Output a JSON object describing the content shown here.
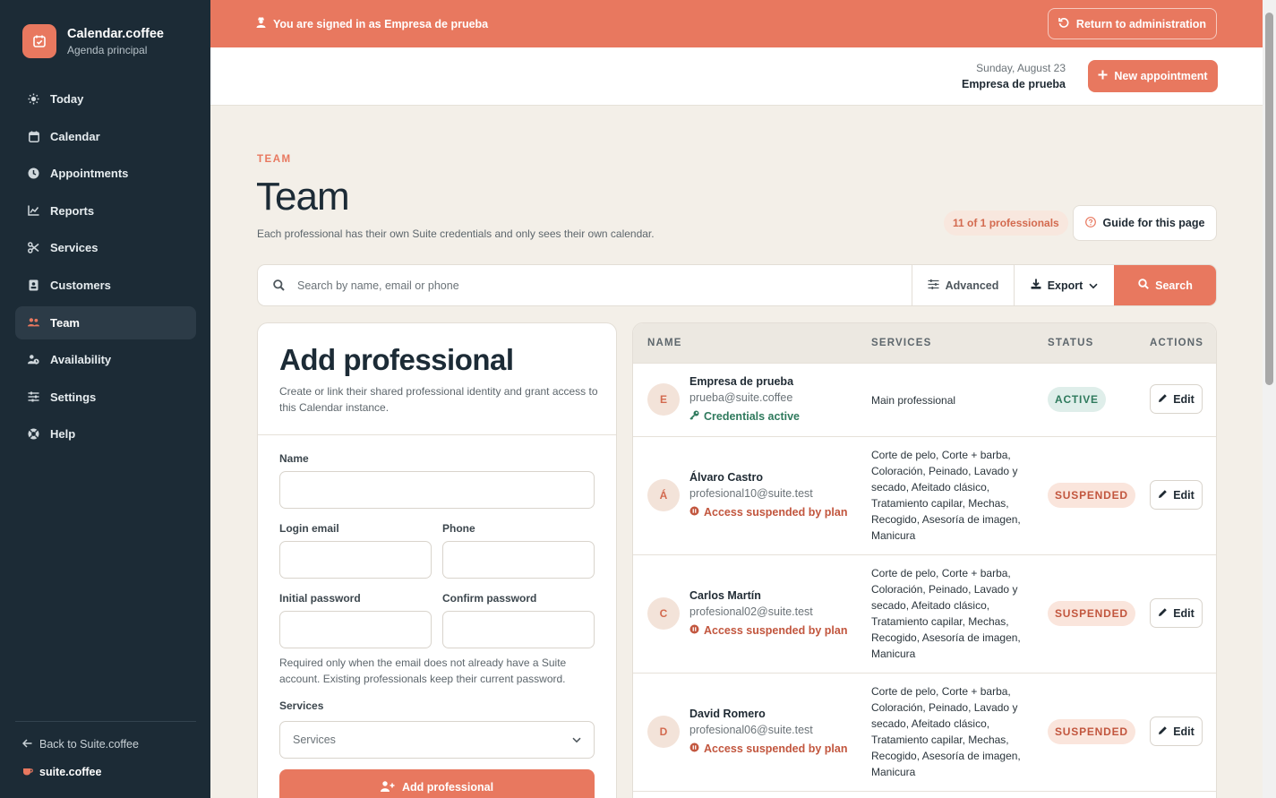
{
  "brand": {
    "title": "Calendar.coffee",
    "subtitle": "Agenda principal"
  },
  "sidebar": {
    "items": [
      {
        "label": "Today",
        "icon": "sun-icon"
      },
      {
        "label": "Calendar",
        "icon": "calendar-icon"
      },
      {
        "label": "Appointments",
        "icon": "clock-icon"
      },
      {
        "label": "Reports",
        "icon": "chart-icon"
      },
      {
        "label": "Services",
        "icon": "scissors-icon"
      },
      {
        "label": "Customers",
        "icon": "contact-icon"
      },
      {
        "label": "Team",
        "icon": "users-icon",
        "active": true
      },
      {
        "label": "Availability",
        "icon": "user-clock-icon"
      },
      {
        "label": "Settings",
        "icon": "sliders-icon"
      },
      {
        "label": "Help",
        "icon": "lifebuoy-icon"
      }
    ],
    "back_link": "Back to Suite.coffee",
    "footer_brand": "suite.coffee"
  },
  "banner": {
    "message": "You are signed in as Empresa de prueba",
    "return_label": "Return to administration"
  },
  "header": {
    "date": "Sunday, August 23",
    "company": "Empresa de prueba",
    "new_appointment": "New appointment"
  },
  "page": {
    "eyebrow": "TEAM",
    "title": "Team",
    "description": "Each professional has their own Suite credentials and only sees their own calendar.",
    "count": "11 of 1 professionals",
    "guide": "Guide for this page"
  },
  "search": {
    "placeholder": "Search by name, email or phone",
    "advanced": "Advanced",
    "export": "Export",
    "search": "Search"
  },
  "add_form": {
    "title": "Add professional",
    "description": "Create or link their shared professional identity and grant access to this Calendar instance.",
    "name_label": "Name",
    "email_label": "Login email",
    "phone_label": "Phone",
    "password_label": "Initial password",
    "confirm_label": "Confirm password",
    "help": "Required only when the email does not already have a Suite account. Existing professionals keep their current password.",
    "services_label": "Services",
    "services_placeholder": "Services",
    "submit": "Add professional"
  },
  "table": {
    "headers": {
      "name": "NAME",
      "services": "SERVICES",
      "status": "STATUS",
      "actions": "ACTIONS"
    },
    "edit_label": "Edit",
    "rows": [
      {
        "initial": "E",
        "name": "Empresa de prueba",
        "email": "prueba@suite.coffee",
        "note": "Credentials active",
        "services": "Main professional",
        "status": "ACTIVE"
      },
      {
        "initial": "Á",
        "name": "Álvaro Castro",
        "email": "profesional10@suite.test",
        "note": "Access suspended by plan",
        "services": "Corte de pelo, Corte + barba, Coloración, Peinado, Lavado y secado, Afeitado clásico, Tratamiento capilar, Mechas, Recogido, Asesoría de imagen, Manicura",
        "status": "SUSPENDED"
      },
      {
        "initial": "C",
        "name": "Carlos Martín",
        "email": "profesional02@suite.test",
        "note": "Access suspended by plan",
        "services": "Corte de pelo, Corte + barba, Coloración, Peinado, Lavado y secado, Afeitado clásico, Tratamiento capilar, Mechas, Recogido, Asesoría de imagen, Manicura",
        "status": "SUSPENDED"
      },
      {
        "initial": "D",
        "name": "David Romero",
        "email": "profesional06@suite.test",
        "note": "Access suspended by plan",
        "services": "Corte de pelo, Corte + barba, Coloración, Peinado, Lavado y secado, Afeitado clásico, Tratamiento capilar, Mechas, Recogido, Asesoría de imagen, Manicura",
        "status": "SUSPENDED"
      }
    ]
  },
  "colors": {
    "accent": "#e8785f",
    "sidebar": "#1c2b36",
    "active_status": "#2f7a5d",
    "suspended_status": "#c2563e"
  }
}
